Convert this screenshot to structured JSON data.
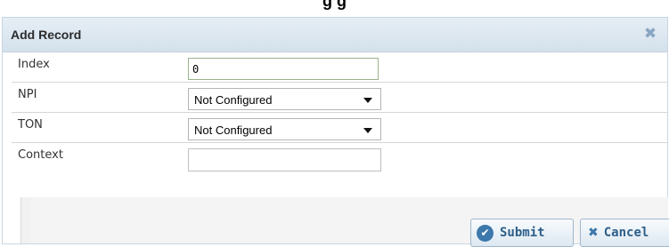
{
  "page": {
    "top_heading_fragment": "g                              g"
  },
  "dialog": {
    "title": "Add Record",
    "close_icon": "close-icon"
  },
  "fields": {
    "index": {
      "label": "Index",
      "value": "0"
    },
    "npi": {
      "label": "NPI",
      "selected": "Not Configured"
    },
    "ton": {
      "label": "TON",
      "selected": "Not Configured"
    },
    "context": {
      "label": "Context",
      "value": ""
    }
  },
  "buttons": {
    "submit_label": "Submit",
    "cancel_label": "Cancel",
    "submit_icon": "check-circle-icon",
    "cancel_icon": "x-icon"
  },
  "colors": {
    "accent": "#3d78ac",
    "titlebar": "#dbe6ef",
    "input_border_active": "#9ab48c"
  }
}
